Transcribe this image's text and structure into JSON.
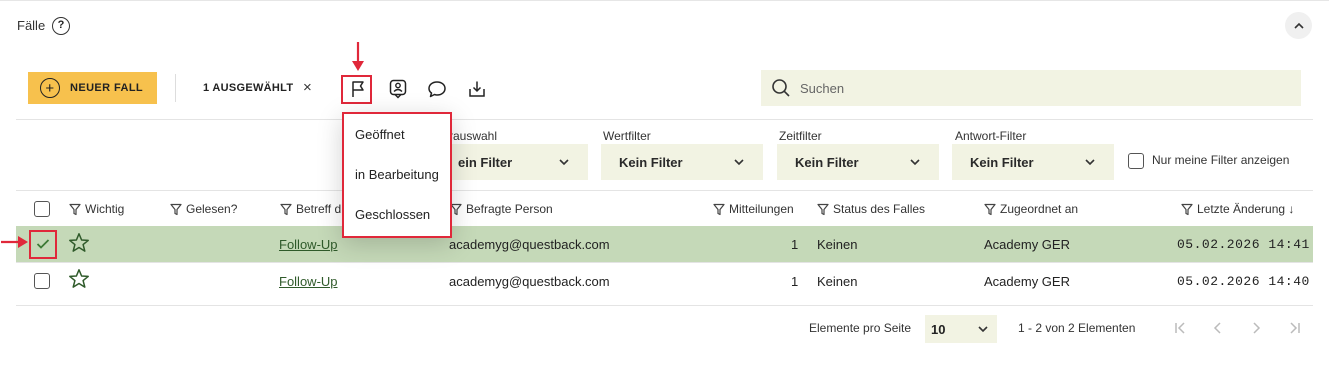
{
  "header": {
    "title": "Fälle",
    "help_icon": "?"
  },
  "toolbar": {
    "new_case_label": "NEUER FALL",
    "selected_label": "1 AUSGEWÄHLT",
    "clear_icon": "×",
    "search_placeholder": "Suchen"
  },
  "status_menu": {
    "items": [
      {
        "label": "Geöffnet"
      },
      {
        "label": "in Bearbeitung"
      },
      {
        "label": "Geschlossen"
      }
    ]
  },
  "filters": [
    {
      "label": "rauswahl",
      "value": "ein Filter"
    },
    {
      "label": "Wertfilter",
      "value": "Kein Filter"
    },
    {
      "label": "Zeitfilter",
      "value": "Kein Filter"
    },
    {
      "label": "Antwort-Filter",
      "value": "Kein Filter"
    }
  ],
  "only_mine_label": "Nur meine Filter anzeigen",
  "table": {
    "columns": [
      "Wichtig",
      "Gelesen?",
      "Betreff d",
      "Befragte Person",
      "Mitteilungen",
      "Status des Falles",
      "Zugeordnet an",
      "Letzte Änderung ↓"
    ],
    "rows": [
      {
        "selected": true,
        "subject": "Follow-Up",
        "person": "academyg@questback.com",
        "messages": "1",
        "status": "Keinen",
        "assigned": "Academy GER",
        "changed": "05.02.2026 14:41"
      },
      {
        "selected": false,
        "subject": "Follow-Up",
        "person": "academyg@questback.com",
        "messages": "1",
        "status": "Keinen",
        "assigned": "Academy GER",
        "changed": "05.02.2026 14:40"
      }
    ]
  },
  "pagination": {
    "per_page_label": "Elemente pro Seite",
    "per_page_value": "10",
    "range_label": "1 - 2 von 2 Elementen"
  },
  "colors": {
    "accent": "#f7c14d",
    "selected_row": "#c5d9b8",
    "filter_bg": "#f2f3e3",
    "annotation_red": "#e0283a"
  }
}
